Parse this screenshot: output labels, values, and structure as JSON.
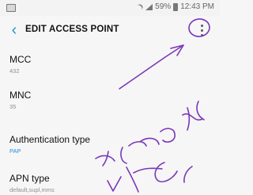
{
  "status_bar": {
    "battery": "59%",
    "time": "12:43 PM"
  },
  "toolbar": {
    "back_icon": "chevron-left-icon",
    "title": "EDIT ACCESS POINT",
    "menu_icon": "more-vert-icon"
  },
  "settings": [
    {
      "label": "MCC",
      "value": "432"
    },
    {
      "label": "MNC",
      "value": "35"
    },
    {
      "label": "Authentication type",
      "value": "PAP"
    },
    {
      "label": "APN type",
      "value": "default,supl,mms"
    }
  ],
  "colors": {
    "accent": "#1d9cc4",
    "annotation": "#7a37b8",
    "selected_value": "#1f8ee9"
  }
}
